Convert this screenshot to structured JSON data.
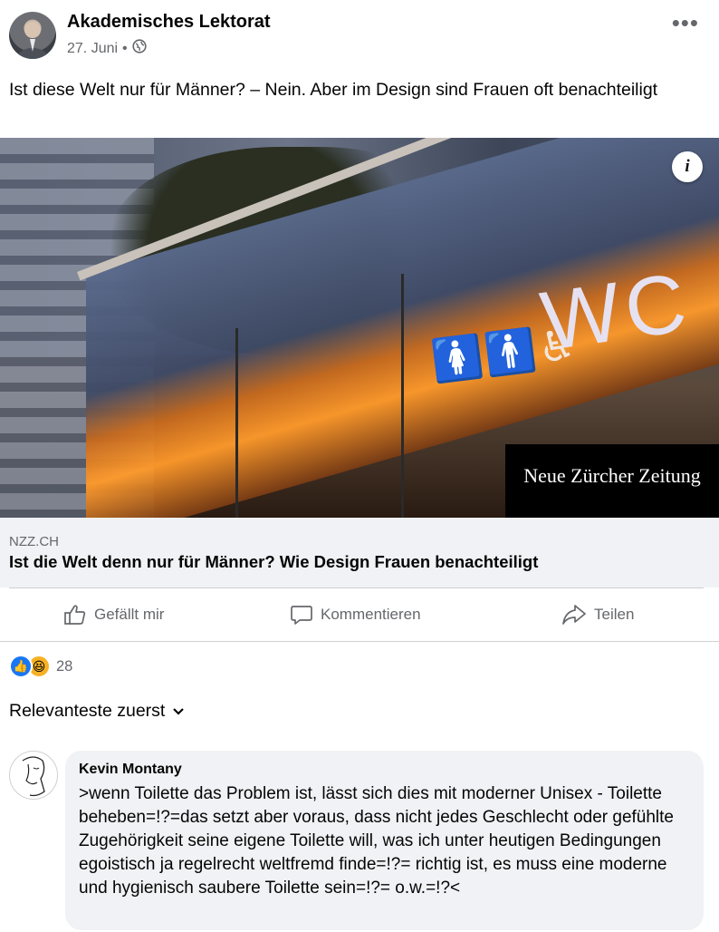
{
  "post": {
    "author": "Akademisches Lektorat",
    "date": "27. Juni",
    "separator": "•",
    "privacy_icon": "globe-icon",
    "more_icon": "more-options-icon",
    "text": "Ist diese Welt nur für Männer? – Nein. Aber im Design sind Frauen oft benachteiligt"
  },
  "image": {
    "sign_text": "WC",
    "badge_text": "Neue Zürcher Zeitung",
    "info_label": "i"
  },
  "link_preview": {
    "domain": "NZZ.CH",
    "title": "Ist die Welt denn nur für Männer? Wie Design Frauen benachteiligt"
  },
  "actions": {
    "like_label": "Gefällt mir",
    "comment_label": "Kommentieren",
    "share_label": "Teilen"
  },
  "reactions": {
    "types": [
      "like-icon",
      "haha-icon"
    ],
    "count": "28"
  },
  "comments": {
    "sort_label": "Relevanteste zuerst",
    "items": [
      {
        "author": "Kevin Montany",
        "text": ">wenn Toilette das Problem ist, lässt sich dies mit moderner Unisex - Toilette beheben=!?=das setzt aber voraus, dass nicht jedes Geschlecht oder gefühlte Zugehörigkeit seine eigene Toilette will, was ich unter heutigen Bedingungen egoistisch ja regelrecht weltfremd finde=!?= richtig ist, es muss eine moderne und hygienisch saubere Toilette sein=!?=  o.w.=!?<"
      }
    ]
  },
  "colors": {
    "secondary_text": "#65676b",
    "preview_bg": "#f0f2f5",
    "like_blue": "#1877f2"
  }
}
